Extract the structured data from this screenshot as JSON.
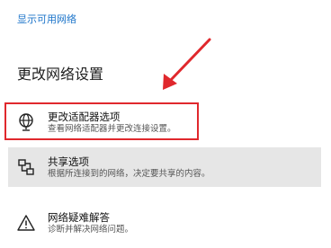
{
  "top_link": {
    "label": "显示可用网络"
  },
  "section": {
    "title": "更改网络设置"
  },
  "items": [
    {
      "title": "更改适配器选项",
      "desc": "查看网络适配器并更改连接设置。",
      "icon": "network-adapter-globe-icon"
    },
    {
      "title": "共享选项",
      "desc": "根据所连接到的网络，决定要共享的内容。",
      "icon": "sharing-icon"
    },
    {
      "title": "网络疑难解答",
      "desc": "诊断并解决网络问题。",
      "icon": "warning-triangle-icon"
    }
  ],
  "annotation": {
    "color": "#e0282d"
  }
}
